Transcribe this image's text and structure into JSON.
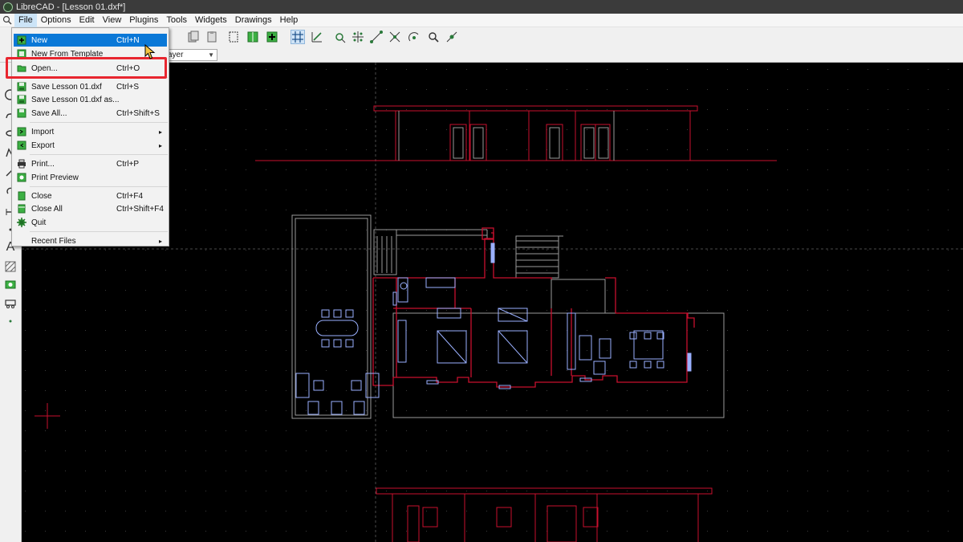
{
  "window": {
    "title": "LibreCAD - [Lesson 01.dxf*]"
  },
  "menubar": {
    "items": [
      "File",
      "Options",
      "Edit",
      "View",
      "Plugins",
      "Tools",
      "Widgets",
      "Drawings",
      "Help"
    ]
  },
  "toolbar": {
    "layer_combo_value": "ayer"
  },
  "file_menu": {
    "items": [
      {
        "label": "New",
        "shortcut": "Ctrl+N",
        "icon": "new-file-icon"
      },
      {
        "label": "New From Template",
        "shortcut": "",
        "icon": "new-template-icon"
      },
      {
        "label": "Open...",
        "shortcut": "Ctrl+O",
        "icon": "open-folder-icon"
      },
      {
        "label": "Save Lesson 01.dxf",
        "shortcut": "Ctrl+S",
        "icon": "save-icon"
      },
      {
        "label": "Save Lesson 01.dxf as...",
        "shortcut": "",
        "icon": "save-as-icon"
      },
      {
        "label": "Save All...",
        "shortcut": "Ctrl+Shift+S",
        "icon": "save-all-icon"
      },
      {
        "label": "Import",
        "shortcut": "",
        "icon": "import-icon"
      },
      {
        "label": "Export",
        "shortcut": "",
        "icon": "export-icon"
      },
      {
        "label": "Print...",
        "shortcut": "Ctrl+P",
        "icon": "print-icon"
      },
      {
        "label": "Print Preview",
        "shortcut": "",
        "icon": "print-preview-icon"
      },
      {
        "label": "Close",
        "shortcut": "Ctrl+F4",
        "icon": "close-file-icon"
      },
      {
        "label": "Close All",
        "shortcut": "Ctrl+Shift+F4",
        "icon": "close-all-icon"
      },
      {
        "label": "Quit",
        "shortcut": "",
        "icon": "quit-icon"
      },
      {
        "label": "Recent Files",
        "shortcut": "",
        "icon": ""
      }
    ],
    "submenu_arrow": "▸"
  },
  "colors": {
    "menu_highlight": "#0a78d7",
    "focus_box": "#e8262f",
    "drawing_red": "#c8102e",
    "drawing_blue": "#9ab0ff",
    "canvas": "#000000",
    "grid_dot": "#3a3a3a"
  }
}
